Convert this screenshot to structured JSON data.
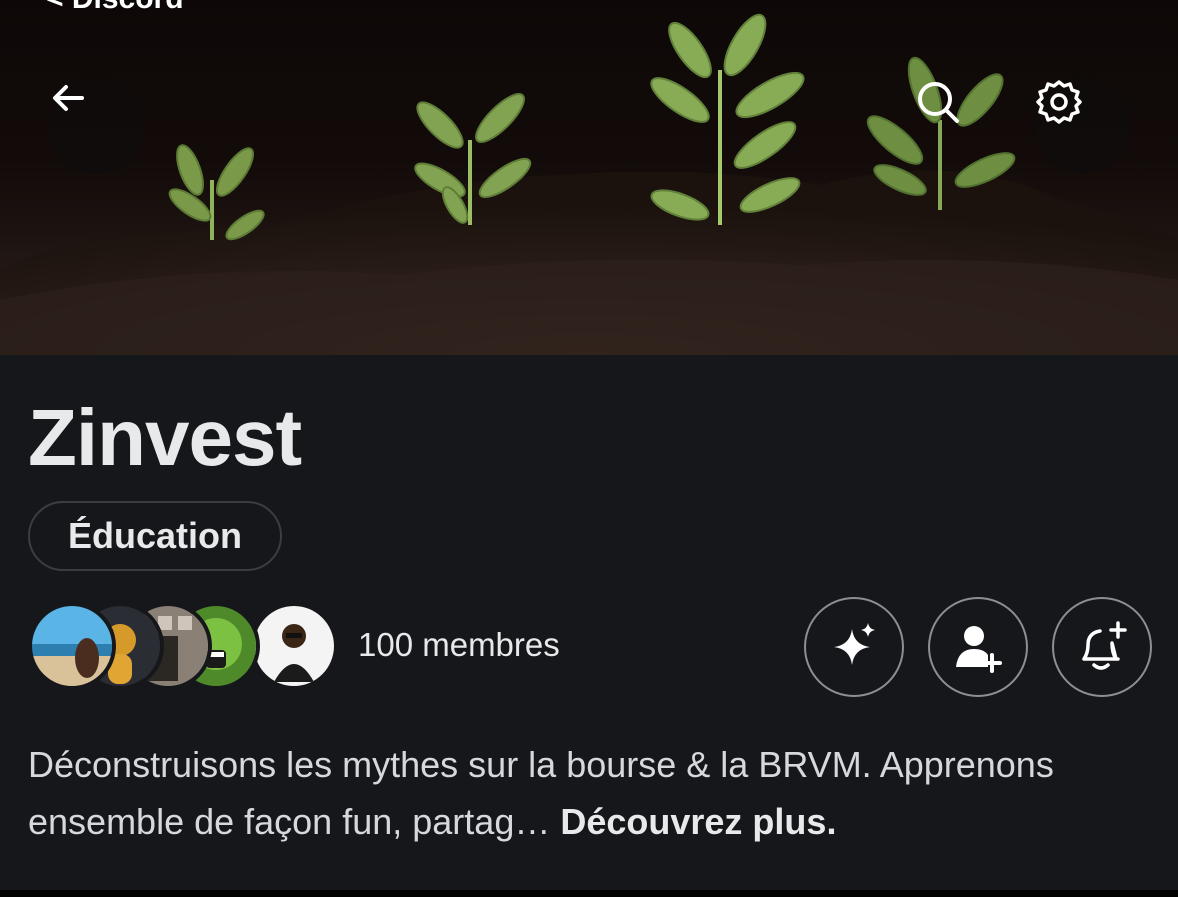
{
  "header": {
    "back_link_label": "< Discord"
  },
  "community": {
    "name": "Zinvest",
    "category": "Éducation",
    "members_label": "100 membres",
    "description": "Déconstruisons les mythes sur la bourse & la BRVM. Apprenons ensemble de façon fun, partag…",
    "more_label": "Découvrez plus."
  },
  "icons": {
    "back": "arrow-left-icon",
    "search": "search-icon",
    "settings": "gear-icon",
    "sparkle": "sparkle-icon",
    "add_member": "add-person-icon",
    "notify": "bell-plus-icon"
  },
  "colors": {
    "background": "#16171b",
    "text": "#e7e9ea",
    "border": "#8b8f95"
  }
}
